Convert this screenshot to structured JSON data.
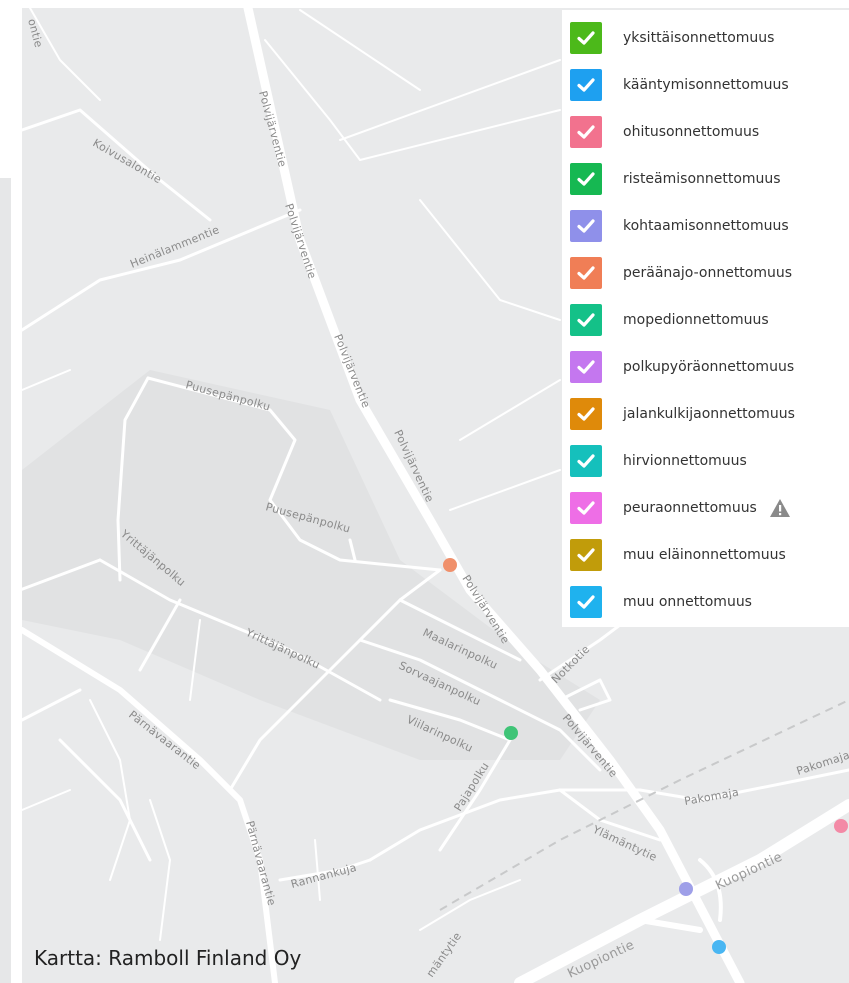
{
  "map": {
    "background": "#e9eaeb",
    "park_color": "#e1e2e3",
    "road_color": "#ffffff",
    "road_labels": [
      "Polvijärventie",
      "Polvijärventie",
      "Polvijärventie",
      "Polvijärventie",
      "Polvijärventie",
      "Polvijärventie",
      "Koivusalontie",
      "Heinälammentie",
      "Puusepänpolku",
      "Puusepänpolku",
      "Yrittäjänpolku",
      "Yrittäjänpolku",
      "Maalarinpolku",
      "Sorvaajanpolku",
      "Viilarinpolku",
      "Pajapolku",
      "Notkotie",
      "Pärnävaarantie",
      "Pärnävaarantie",
      "Rannankuja",
      "Pakomaja",
      "Pakomaja",
      "Ylämäntytie",
      "Kuopiontie",
      "Kuopiontie",
      "mäntytie",
      "ontie"
    ]
  },
  "legend": {
    "items": [
      {
        "label": "yksittäisonnettomuus",
        "color": "#4cb91a"
      },
      {
        "label": "kääntymisonnettomuus",
        "color": "#1ea0f0"
      },
      {
        "label": "ohitusonnettomuus",
        "color": "#f2728e"
      },
      {
        "label": "risteämisonnettomuus",
        "color": "#16b852"
      },
      {
        "label": "kohtaamisonnettomuus",
        "color": "#8f90ea"
      },
      {
        "label": "peräänajo-onnettomuus",
        "color": "#f07e56"
      },
      {
        "label": "mopedionnettomuus",
        "color": "#14c188"
      },
      {
        "label": "polkupyöräonnettomuus",
        "color": "#c477ef"
      },
      {
        "label": "jalankulkijaonnettomuus",
        "color": "#df8a0a"
      },
      {
        "label": "hirvionnettomuus",
        "color": "#15c0bc"
      },
      {
        "label": "peuraonnettomuus",
        "color": "#ee6ee6",
        "warning": true
      },
      {
        "label": "muu eläinonnettomuus",
        "color": "#c19c0a"
      },
      {
        "label": "muu onnettomuus",
        "color": "#1fb2ee"
      }
    ]
  },
  "markers": [
    {
      "type": "peräänajo-onnettomuus",
      "color": "#f0906b"
    },
    {
      "type": "risteämisonnettomuus",
      "color": "#3fc477"
    },
    {
      "type": "kohtaamisonnettomuus",
      "color": "#9e9fe8"
    },
    {
      "type": "kääntymisonnettomuus",
      "color": "#49b6f2"
    },
    {
      "type": "ohitusonnettomuus",
      "color": "#f38aa6"
    }
  ],
  "credit": "Kartta: Ramboll Finland Oy"
}
